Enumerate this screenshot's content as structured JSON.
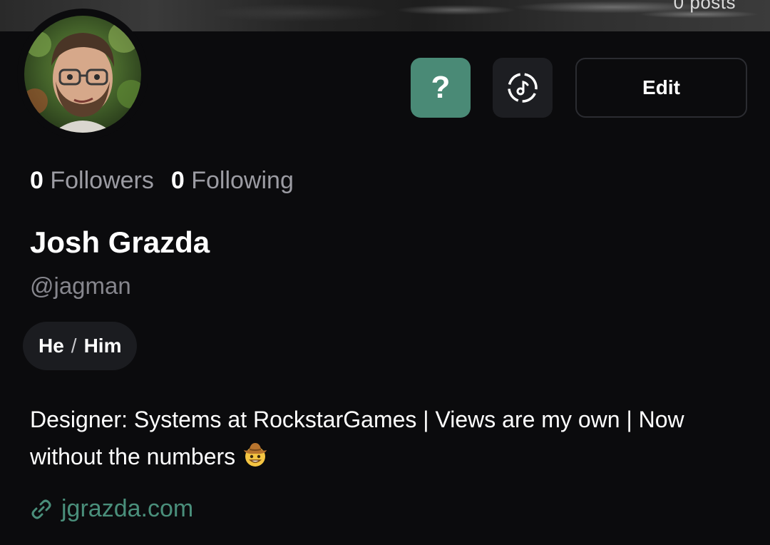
{
  "banner": {
    "posts_label": "0 posts"
  },
  "actions": {
    "help_label": "?",
    "music_icon": "music-disc-icon",
    "edit_label": "Edit"
  },
  "stats": {
    "followers_count": "0",
    "followers_label": "Followers",
    "following_count": "0",
    "following_label": "Following"
  },
  "profile": {
    "display_name": "Josh Grazda",
    "handle": "@jagman",
    "pronoun_1": "He",
    "pronoun_sep": "/",
    "pronoun_2": "Him",
    "bio": "Designer: Systems at RockstarGames | Views are my own | Now without the numbers",
    "bio_emoji": "cowboy-face-emoji",
    "website": "jgrazda.com"
  },
  "colors": {
    "background": "#0b0b0d",
    "accent": "#4a8a76",
    "link": "#4a8f7b",
    "muted_text": "#9c9ca3",
    "chip_bg": "#1b1c20"
  }
}
